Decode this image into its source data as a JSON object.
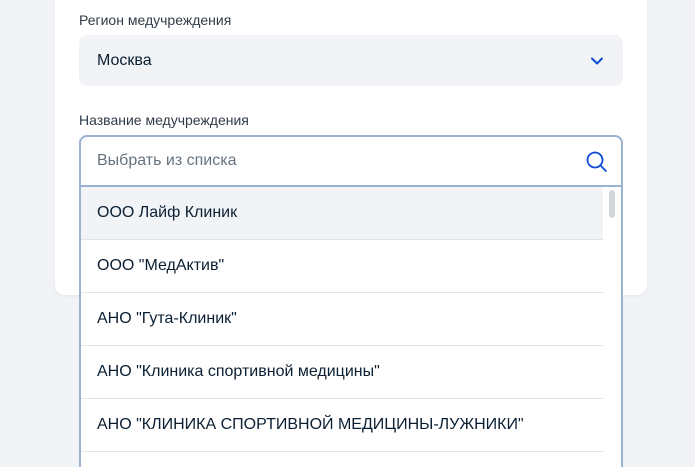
{
  "form": {
    "region": {
      "label": "Регион медучреждения",
      "value": "Москва",
      "icon": "chevron-down-icon"
    },
    "institution": {
      "label": "Название медучреждения",
      "placeholder": "Выбрать из списка",
      "value": "",
      "icon": "search-icon"
    },
    "options": [
      "ООО Лайф Клиник",
      "ООО \"МедАктив\"",
      "АНО \"Гута-Клиник\"",
      "АНО \"Клиника спортивной медицины\"",
      "АНО \"КЛИНИКА СПОРТИВНОЙ МЕДИЦИНЫ-ЛУЖНИКИ\""
    ],
    "highlighted_index": 0
  },
  "colors": {
    "accent": "#0d4cd3",
    "border_active": "#99b3d1",
    "field_background": "#f1f3f7",
    "text": "#0b1f33",
    "placeholder": "#66727f"
  }
}
